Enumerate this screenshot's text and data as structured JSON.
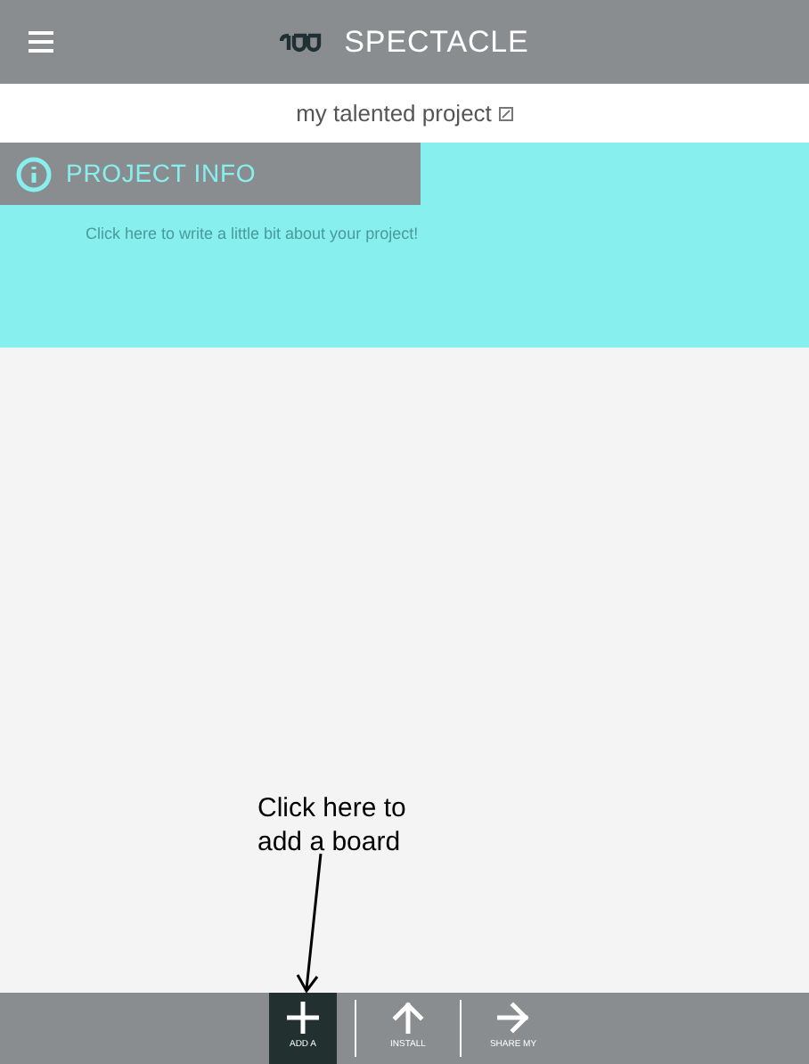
{
  "header": {
    "title": "SPECTACLE"
  },
  "project": {
    "name": "my talented project"
  },
  "info": {
    "title": "PROJECT INFO",
    "placeholder": "Click here to write a little bit about your project!"
  },
  "annotation": {
    "text": "Click here to add a board"
  },
  "toolbar": [
    {
      "kind": "add",
      "label": "ADD A",
      "selected": true
    },
    {
      "kind": "up",
      "label": "INSTALL",
      "selected": false
    },
    {
      "kind": "right",
      "label": "SHARE MY",
      "selected": false
    }
  ]
}
